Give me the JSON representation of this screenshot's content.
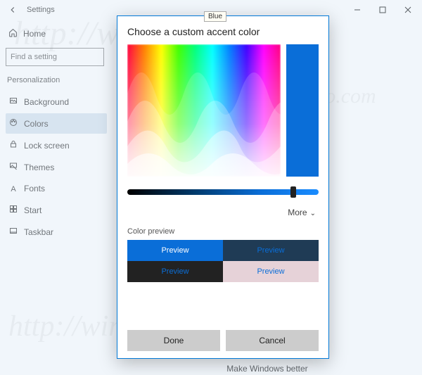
{
  "window": {
    "title": "Settings"
  },
  "sidebar": {
    "home": "Home",
    "search_placeholder": "Find a setting",
    "section": "Personalization",
    "items": [
      {
        "label": "Background"
      },
      {
        "label": "Colors",
        "selected": true
      },
      {
        "label": "Lock screen"
      },
      {
        "label": "Themes"
      },
      {
        "label": "Fonts"
      },
      {
        "label": "Start"
      },
      {
        "label": "Taskbar"
      }
    ]
  },
  "main": {
    "footer_hint": "Make Windows better"
  },
  "dialog": {
    "title": "Choose a custom accent color",
    "tooltip": "Blue",
    "more": "More",
    "preview_label": "Color preview",
    "preview_word": "Preview",
    "done": "Done",
    "cancel": "Cancel",
    "selected_color": "#0a6ed8",
    "value_slider_position": 0.85
  }
}
